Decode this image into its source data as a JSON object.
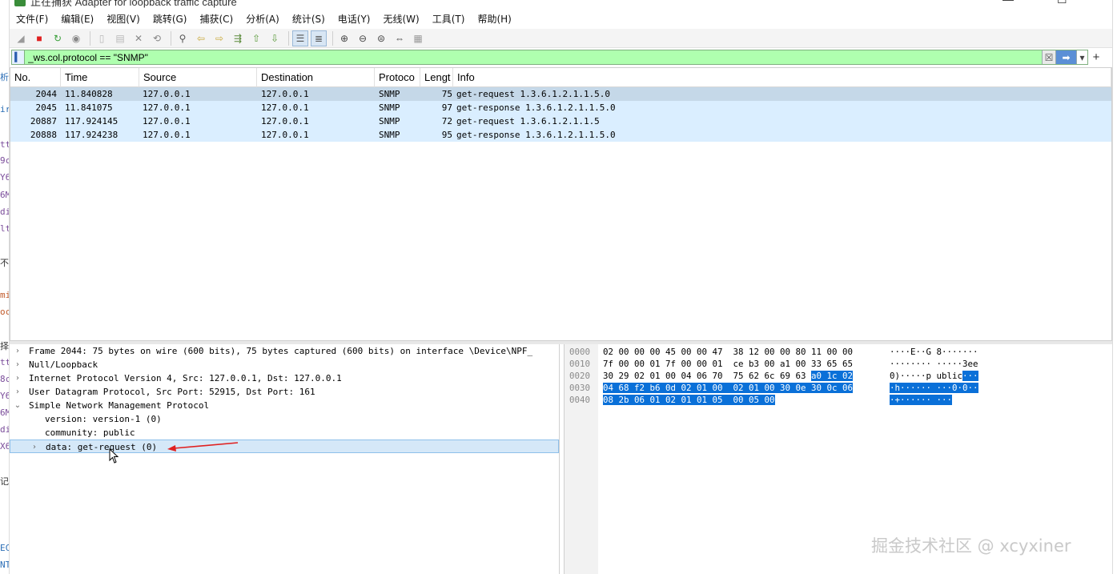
{
  "window": {
    "title": "正在捕获 Adapter for loopback traffic capture",
    "min_glyph": "—",
    "max_glyph": "☐"
  },
  "background_strip": {
    "lines": [
      {
        "text": "析",
        "color": "#2a6db5"
      },
      {
        "text": "ir",
        "color": "#2a6db5"
      },
      {
        "text": "tt",
        "color": "#7a4c9a"
      },
      {
        "text": "9c",
        "color": "#7a4c9a"
      },
      {
        "text": "Y6",
        "color": "#7a4c9a"
      },
      {
        "text": "6M",
        "color": "#7a4c9a"
      },
      {
        "text": "di",
        "color": "#7a4c9a"
      },
      {
        "text": "lt",
        "color": "#7a4c9a"
      },
      {
        "text": "不设",
        "color": "#333333"
      },
      {
        "text": "mi",
        "color": "#c05a2a"
      },
      {
        "text": "oc",
        "color": "#c05a2a"
      },
      {
        "text": "择",
        "color": "#333333"
      },
      {
        "text": "tt",
        "color": "#7a4c9a"
      },
      {
        "text": "8c",
        "color": "#7a4c9a"
      },
      {
        "text": "Y6",
        "color": "#7a4c9a"
      },
      {
        "text": "6M",
        "color": "#7a4c9a"
      },
      {
        "text": "di",
        "color": "#7a4c9a"
      },
      {
        "text": "X6",
        "color": "#7a4c9a"
      },
      {
        "text": "记录",
        "color": "#333333"
      },
      {
        "text": "EC",
        "color": "#2a6db5"
      },
      {
        "text": "NT",
        "color": "#2a6db5"
      }
    ]
  },
  "menu": [
    "文件(F)",
    "编辑(E)",
    "视图(V)",
    "跳转(G)",
    "捕获(C)",
    "分析(A)",
    "统计(S)",
    "电话(Y)",
    "无线(W)",
    "工具(T)",
    "帮助(H)"
  ],
  "toolbar": {
    "icons": [
      {
        "name": "shark-fin-start-icon",
        "glyph": "◢",
        "color": "#9a9a9a",
        "pressed": false
      },
      {
        "name": "stop-capture-icon",
        "glyph": "■",
        "color": "#e02020",
        "pressed": false
      },
      {
        "name": "restart-capture-icon",
        "glyph": "↻",
        "color": "#3aa03a",
        "pressed": false
      },
      {
        "name": "capture-options-icon",
        "glyph": "◉",
        "color": "#888888",
        "pressed": false
      },
      {
        "name": "open-file-icon",
        "glyph": "▯",
        "color": "#b8b8b8",
        "pressed": false
      },
      {
        "name": "save-file-icon",
        "glyph": "▤",
        "color": "#b8b8b8",
        "pressed": false
      },
      {
        "name": "close-file-icon",
        "glyph": "✕",
        "color": "#888888",
        "pressed": false
      },
      {
        "name": "reload-file-icon",
        "glyph": "⟲",
        "color": "#888888",
        "pressed": false
      },
      {
        "name": "find-packet-icon",
        "glyph": "⚲",
        "color": "#555555",
        "pressed": false
      },
      {
        "name": "go-back-icon",
        "glyph": "⇦",
        "color": "#c9a93a",
        "pressed": false
      },
      {
        "name": "go-forward-icon",
        "glyph": "⇨",
        "color": "#c9a93a",
        "pressed": false
      },
      {
        "name": "go-to-packet-icon",
        "glyph": "⇶",
        "color": "#5a8a3a",
        "pressed": false
      },
      {
        "name": "first-packet-icon",
        "glyph": "⇧",
        "color": "#5a9a3a",
        "pressed": false
      },
      {
        "name": "last-packet-icon",
        "glyph": "⇩",
        "color": "#5a9a3a",
        "pressed": false
      },
      {
        "name": "autoscroll-icon",
        "glyph": "☰",
        "color": "#555555",
        "pressed": true
      },
      {
        "name": "colorize-icon",
        "glyph": "≣",
        "color": "#555555",
        "pressed": true
      },
      {
        "name": "zoom-in-icon",
        "glyph": "⊕",
        "color": "#444444",
        "pressed": false
      },
      {
        "name": "zoom-out-icon",
        "glyph": "⊖",
        "color": "#444444",
        "pressed": false
      },
      {
        "name": "zoom-normal-icon",
        "glyph": "⊜",
        "color": "#444444",
        "pressed": false
      },
      {
        "name": "resize-columns-icon",
        "glyph": "⇔",
        "color": "#444444",
        "pressed": false
      },
      {
        "name": "layout-grid-icon",
        "glyph": "▦",
        "color": "#999999",
        "pressed": false
      }
    ]
  },
  "filter": {
    "value": "_ws.col.protocol == \"SNMP\"",
    "clear_glyph": "☒",
    "apply_glyph": "➡",
    "dropdown_glyph": "▾",
    "add_glyph": "+"
  },
  "packet_list": {
    "columns": [
      "No.",
      "Time",
      "Source",
      "Destination",
      "Protoco",
      "Lengt",
      "Info"
    ],
    "rows": [
      {
        "no": "2044",
        "time": "11.840828",
        "src": "127.0.0.1",
        "dst": "127.0.0.1",
        "proto": "SNMP",
        "len": "75",
        "info": "get-request 1.3.6.1.2.1.1.5.0",
        "selected": true
      },
      {
        "no": "2045",
        "time": "11.841075",
        "src": "127.0.0.1",
        "dst": "127.0.0.1",
        "proto": "SNMP",
        "len": "97",
        "info": "get-response 1.3.6.1.2.1.1.5.0",
        "selected": false
      },
      {
        "no": "20887",
        "time": "117.924145",
        "src": "127.0.0.1",
        "dst": "127.0.0.1",
        "proto": "SNMP",
        "len": "72",
        "info": "get-request 1.3.6.1.2.1.1.5",
        "selected": false
      },
      {
        "no": "20888",
        "time": "117.924238",
        "src": "127.0.0.1",
        "dst": "127.0.0.1",
        "proto": "SNMP",
        "len": "95",
        "info": "get-response 1.3.6.1.2.1.1.5.0",
        "selected": false
      }
    ]
  },
  "details": {
    "rows": [
      {
        "arrow": "›",
        "indent": 0,
        "text": "Frame 2044: 75 bytes on wire (600 bits), 75 bytes captured (600 bits) on interface \\Device\\NPF_",
        "selected": false
      },
      {
        "arrow": "›",
        "indent": 0,
        "text": "Null/Loopback",
        "selected": false
      },
      {
        "arrow": "›",
        "indent": 0,
        "text": "Internet Protocol Version 4, Src: 127.0.0.1, Dst: 127.0.0.1",
        "selected": false
      },
      {
        "arrow": "›",
        "indent": 0,
        "text": "User Datagram Protocol, Src Port: 52915, Dst Port: 161",
        "selected": false
      },
      {
        "arrow": "⌄",
        "indent": 0,
        "text": "Simple Network Management Protocol",
        "selected": false
      },
      {
        "arrow": "",
        "indent": 1,
        "text": "version: version-1 (0)",
        "selected": false
      },
      {
        "arrow": "",
        "indent": 1,
        "text": "community: public",
        "selected": false
      },
      {
        "arrow": "›",
        "indent": 1,
        "text": "data: get-request (0)",
        "selected": true
      }
    ]
  },
  "hex": {
    "rows": [
      {
        "offset": "0000",
        "hex_plain": "02 00 00 00 45 00 00 47  38 12 00 00 80 11 00 00",
        "hex_hl": "",
        "ascii_plain": "····E··G 8·······",
        "ascii_hl": ""
      },
      {
        "offset": "0010",
        "hex_plain": "7f 00 00 01 7f 00 00 01  ce b3 00 a1 00 33 65 65",
        "hex_hl": "",
        "ascii_plain": "········ ·····3ee",
        "ascii_hl": ""
      },
      {
        "offset": "0020",
        "hex_plain": "30 29 02 01 00 04 06 70  75 62 6c 69 63 ",
        "hex_hl": "a0 1c 02",
        "ascii_plain": "0)·····p ublic",
        "ascii_hl": "···"
      },
      {
        "offset": "0030",
        "hex_plain": "",
        "hex_hl": "04 68 f2 b6 0d 02 01 00  02 01 00 30 0e 30 0c 06",
        "ascii_plain": "",
        "ascii_hl": "·h······ ···0·0··"
      },
      {
        "offset": "0040",
        "hex_plain": "",
        "hex_hl": "08 2b 06 01 02 01 01 05  00 05 00",
        "ascii_plain": "",
        "ascii_hl": "·+······ ···"
      }
    ]
  },
  "annotation": {
    "color": "#e02020"
  },
  "watermark": "掘金技术社区 @ xcyxiner"
}
